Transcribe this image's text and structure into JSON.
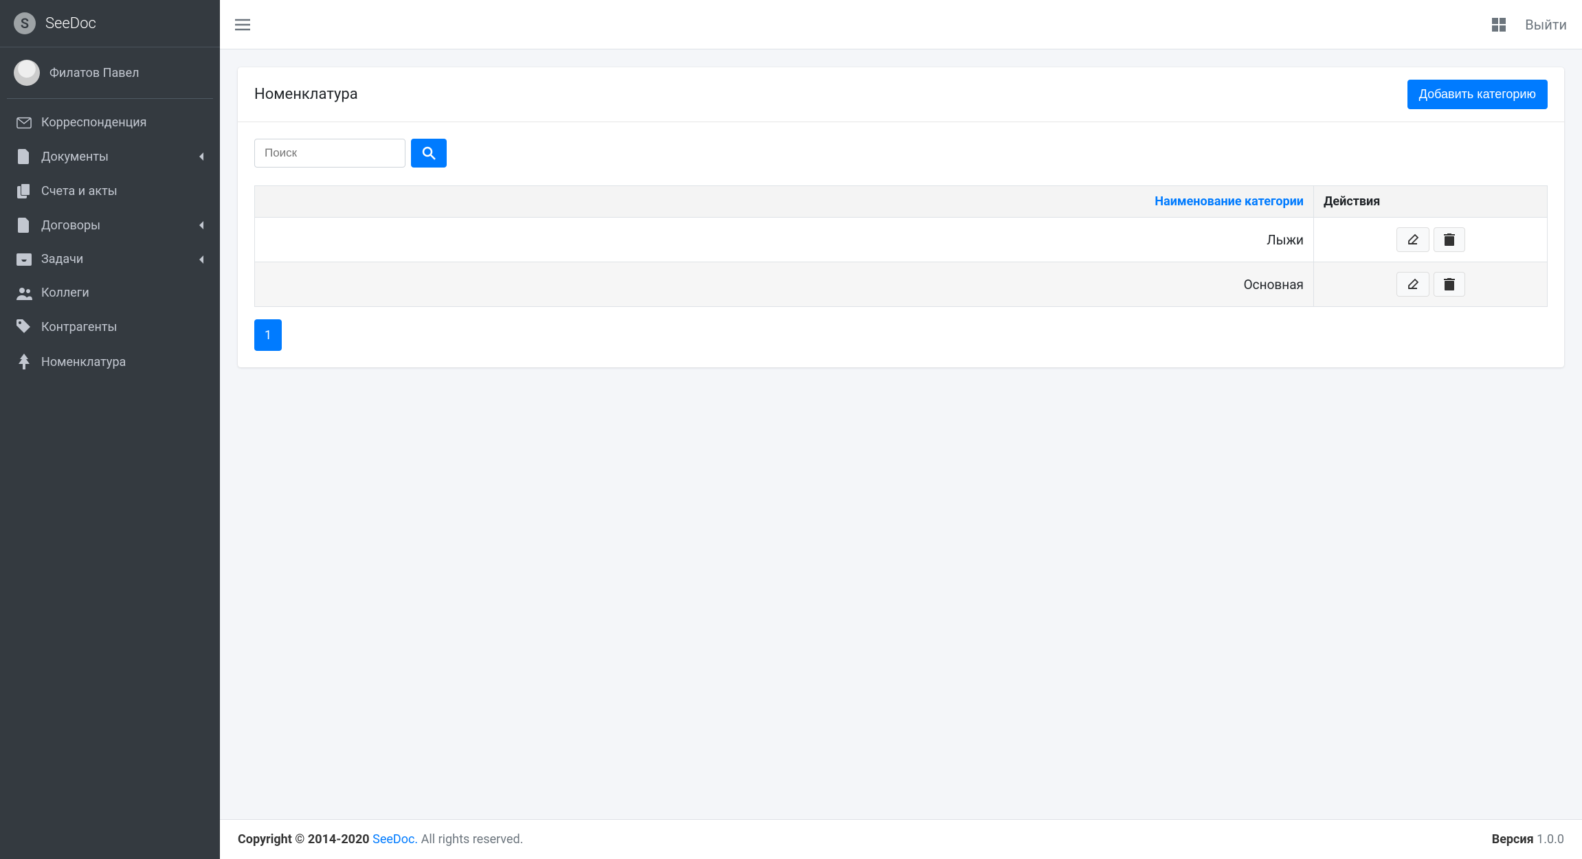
{
  "brand": {
    "logo_letter": "S",
    "name": "SeeDoc"
  },
  "user": {
    "name": "Филатов Павел"
  },
  "sidebar": {
    "items": [
      {
        "label": "Корреспонденция",
        "icon": "envelope",
        "expandable": false
      },
      {
        "label": "Документы",
        "icon": "file",
        "expandable": true
      },
      {
        "label": "Счета и акты",
        "icon": "copy",
        "expandable": false
      },
      {
        "label": "Договоры",
        "icon": "file",
        "expandable": true
      },
      {
        "label": "Задачи",
        "icon": "inbox",
        "expandable": true
      },
      {
        "label": "Коллеги",
        "icon": "users",
        "expandable": false
      },
      {
        "label": "Контрагенты",
        "icon": "tag",
        "expandable": false
      },
      {
        "label": "Номенклатура",
        "icon": "tree",
        "expandable": false
      }
    ]
  },
  "navbar": {
    "logout": "Выйти"
  },
  "page": {
    "title": "Номенклатура",
    "add_button": "Добавить категорию",
    "search_placeholder": "Поиск",
    "columns": {
      "name": "Наименование категории",
      "actions": "Действия"
    },
    "rows": [
      {
        "name": "Лыжи"
      },
      {
        "name": "Основная"
      }
    ],
    "pagination": {
      "current": "1"
    }
  },
  "footer": {
    "copyright_prefix": "Copyright © 2014-2020 ",
    "brand": "SeeDoc.",
    "rights": " All rights reserved.",
    "version_label": "Версия ",
    "version": "1.0.0"
  }
}
